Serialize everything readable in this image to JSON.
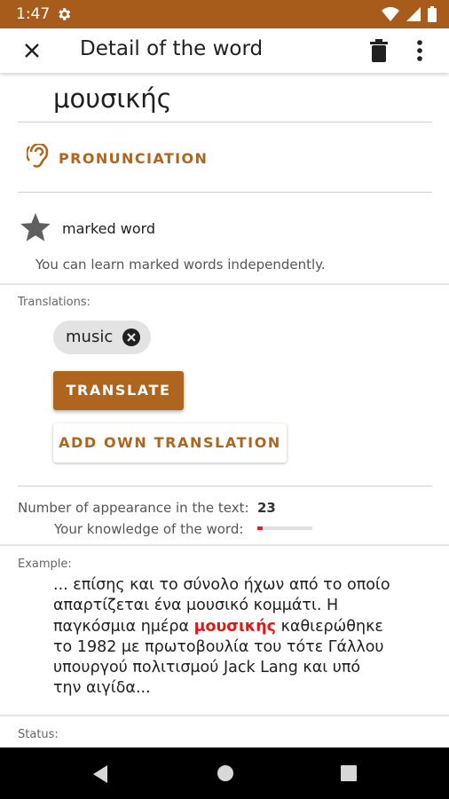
{
  "status_bar": {
    "time": "1:47",
    "icons": [
      "settings-gear-icon",
      "wifi-icon",
      "cell-signal-icon",
      "battery-icon"
    ]
  },
  "app_bar": {
    "title": "Detail of the word",
    "icons": [
      "close-icon",
      "delete-icon",
      "more-vert-icon"
    ]
  },
  "word": "μουσικής",
  "pronunciation": {
    "label": "PRONUNCIATION",
    "icon": "hearing-icon"
  },
  "marked": {
    "label": "marked word",
    "info": "You can learn marked words independently.",
    "icon": "star-icon"
  },
  "translations": {
    "label": "Translations:",
    "chips": [
      "music"
    ],
    "translate_button": "TRANSLATE",
    "add_own_button": "ADD OWN TRANSLATION"
  },
  "stats": {
    "appearance_label": "Number of appearance in the text:",
    "appearance_value": "23",
    "knowledge_label": "Your knowledge of the word:",
    "knowledge_level": 0.1
  },
  "example": {
    "label": "Example:",
    "before": "... επίσης και το σύνολο ήχων από το οποίο απαρτίζεται ένα μουσικό κομμάτι. Η παγκόσμια ημέρα ",
    "highlight": "μουσικής",
    "after": " καθιερώθηκε το 1982 με πρωτοβουλία του τότε Γάλλου υπουργού πολιτισμού Jack Lang και υπό την αιγίδα..."
  },
  "status": {
    "label": "Status:"
  },
  "colors": {
    "accent": "#b0651f",
    "status_bar": "#a85c1b",
    "highlight": "#e01818"
  }
}
